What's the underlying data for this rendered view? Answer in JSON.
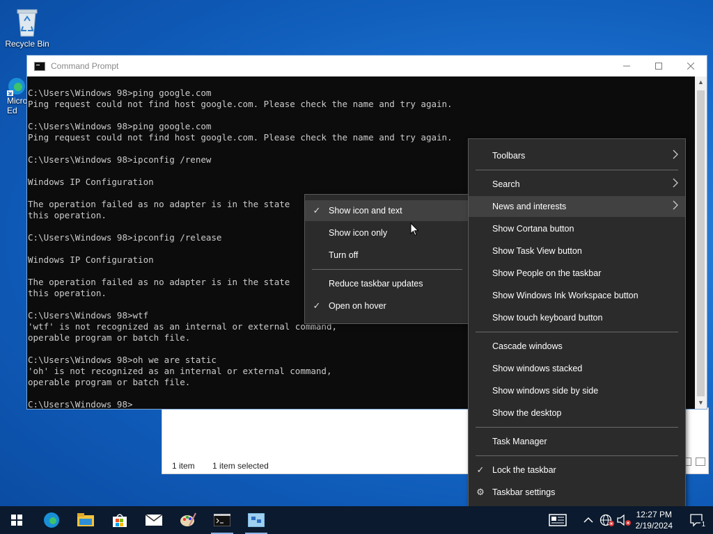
{
  "desktop": {
    "recycle_bin_label": "Recycle Bin",
    "edge_label_line1": "Micro",
    "edge_label_line2": "Ed"
  },
  "explorer": {
    "item_count": "1 item",
    "selected_count": "1 item selected"
  },
  "cmd": {
    "title": "Command Prompt",
    "lines": [
      "C:\\Users\\Windows 98>ping google.com",
      "Ping request could not find host google.com. Please check the name and try again.",
      "",
      "C:\\Users\\Windows 98>ping google.com",
      "Ping request could not find host google.com. Please check the name and try again.",
      "",
      "C:\\Users\\Windows 98>ipconfig /renew",
      "",
      "Windows IP Configuration",
      "",
      "The operation failed as no adapter is in the state",
      "this operation.",
      "",
      "C:\\Users\\Windows 98>ipconfig /release",
      "",
      "Windows IP Configuration",
      "",
      "The operation failed as no adapter is in the state",
      "this operation.",
      "",
      "C:\\Users\\Windows 98>wtf",
      "'wtf' is not recognized as an internal or external command,",
      "operable program or batch file.",
      "",
      "C:\\Users\\Windows 98>oh we are static",
      "'oh' is not recognized as an internal or external command,",
      "operable program or batch file.",
      "",
      "C:\\Users\\Windows 98>"
    ]
  },
  "submenu": {
    "items": [
      {
        "label": "Show icon and text",
        "checked": true
      },
      {
        "label": "Show icon only",
        "checked": false
      },
      {
        "label": "Turn off",
        "checked": false
      },
      {
        "label": "Reduce taskbar updates",
        "checked": false
      },
      {
        "label": "Open on hover",
        "checked": true
      }
    ]
  },
  "taskbar_menu": {
    "items": [
      {
        "label": "Toolbars",
        "submenu": true
      },
      {
        "label": "Search",
        "submenu": true
      },
      {
        "label": "News and interests",
        "submenu": true
      },
      {
        "label": "Show Cortana button"
      },
      {
        "label": "Show Task View button"
      },
      {
        "label": "Show People on the taskbar"
      },
      {
        "label": "Show Windows Ink Workspace button"
      },
      {
        "label": "Show touch keyboard button"
      },
      {
        "label": "Cascade windows"
      },
      {
        "label": "Show windows stacked"
      },
      {
        "label": "Show windows side by side"
      },
      {
        "label": "Show the desktop"
      },
      {
        "label": "Task Manager"
      },
      {
        "label": "Lock the taskbar",
        "checked": true
      },
      {
        "label": "Taskbar settings",
        "icon": "gear-icon"
      }
    ]
  },
  "tray": {
    "time": "12:27 PM",
    "date": "2/19/2024",
    "notification_count": "1"
  },
  "colors": {
    "menu_bg": "#2b2b2b",
    "menu_hover": "#414141",
    "console_bg": "#0c0c0c",
    "console_text": "#cccccc",
    "taskbar_bg": "#0b1a2e"
  }
}
